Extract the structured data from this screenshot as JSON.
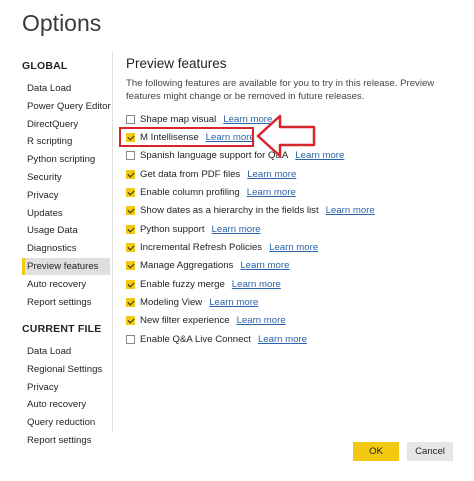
{
  "window": {
    "title": "Options"
  },
  "sidebar": {
    "global_heading": "GLOBAL",
    "global_items": [
      "Data Load",
      "Power Query Editor",
      "DirectQuery",
      "R scripting",
      "Python scripting",
      "Security",
      "Privacy",
      "Updates",
      "Usage Data",
      "Diagnostics",
      "Preview features",
      "Auto recovery",
      "Report settings"
    ],
    "current_heading": "CURRENT FILE",
    "current_items": [
      "Data Load",
      "Regional Settings",
      "Privacy",
      "Auto recovery",
      "Query reduction",
      "Report settings"
    ],
    "selected_item": "Preview features"
  },
  "main": {
    "title": "Preview features",
    "description": "The following features are available for you to try in this release. Preview features might change or be removed in future releases.",
    "learn_more_label": "Learn more",
    "features": [
      {
        "label": "Shape map visual",
        "checked": false
      },
      {
        "label": "M Intellisense",
        "checked": true
      },
      {
        "label": "Spanish language support for Q&A",
        "checked": false
      },
      {
        "label": "Get data from PDF files",
        "checked": true
      },
      {
        "label": "Enable column profiling",
        "checked": true
      },
      {
        "label": "Show dates as a hierarchy in the fields list",
        "checked": true
      },
      {
        "label": "Python support",
        "checked": true
      },
      {
        "label": "Incremental Refresh Policies",
        "checked": true
      },
      {
        "label": "Manage Aggregations",
        "checked": true
      },
      {
        "label": "Enable fuzzy merge",
        "checked": true
      },
      {
        "label": "Modeling View",
        "checked": true
      },
      {
        "label": "New filter experience",
        "checked": true
      },
      {
        "label": "Enable Q&A Live Connect",
        "checked": false
      }
    ]
  },
  "footer": {
    "ok_label": "OK",
    "cancel_label": "Cancel"
  },
  "colors": {
    "accent": "#f2c811",
    "link": "#2b63a8",
    "annotation": "#d7262b"
  }
}
